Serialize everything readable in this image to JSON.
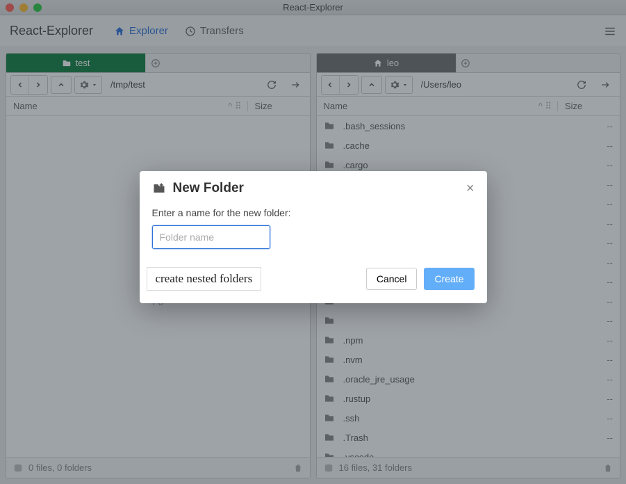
{
  "window": {
    "title": "React-Explorer"
  },
  "toolbar": {
    "brand": "React-Explorer",
    "explorer_label": "Explorer",
    "transfers_label": "Transfers"
  },
  "left_pane": {
    "tab": {
      "label": "test"
    },
    "path": "/tmp/test",
    "columns": {
      "name": "Name",
      "size": "Size"
    },
    "empty_hint": "Fo",
    "status": "0 files, 0 folders",
    "files": []
  },
  "right_pane": {
    "tab": {
      "label": "leo"
    },
    "path": "/Users/leo",
    "columns": {
      "name": "Name",
      "size": "Size"
    },
    "status": "16 files, 31 folders",
    "files": [
      {
        "name": ".bash_sessions",
        "size": "--"
      },
      {
        "name": ".cache",
        "size": "--"
      },
      {
        "name": ".cargo",
        "size": "--"
      },
      {
        "name": "",
        "size": "--"
      },
      {
        "name": "",
        "size": "--"
      },
      {
        "name": "",
        "size": "--"
      },
      {
        "name": "",
        "size": "--"
      },
      {
        "name": "",
        "size": "--"
      },
      {
        "name": "",
        "size": "--"
      },
      {
        "name": "",
        "size": "--"
      },
      {
        "name": "",
        "size": "--"
      },
      {
        "name": ".npm",
        "size": "--"
      },
      {
        "name": ".nvm",
        "size": "--"
      },
      {
        "name": ".oracle_jre_usage",
        "size": "--"
      },
      {
        "name": ".rustup",
        "size": "--"
      },
      {
        "name": ".ssh",
        "size": "--"
      },
      {
        "name": ".Trash",
        "size": "--"
      },
      {
        "name": ".vscode",
        "size": "--"
      }
    ]
  },
  "dialog": {
    "title": "New Folder",
    "prompt": "Enter a name for the new folder:",
    "placeholder": "Folder name",
    "hint": "create nested folders",
    "cancel": "Cancel",
    "create": "Create"
  }
}
